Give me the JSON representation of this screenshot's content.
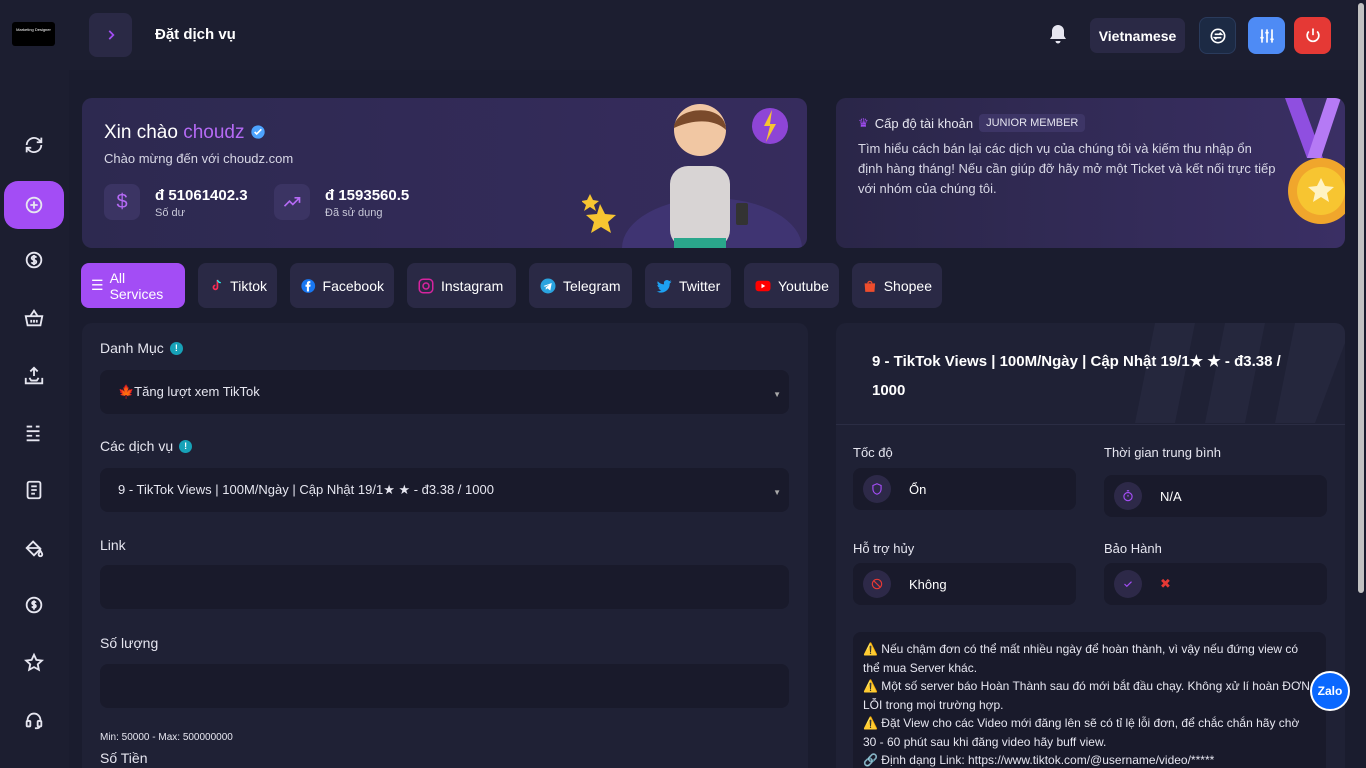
{
  "app": {
    "logo_text": "Marketing Designer"
  },
  "header": {
    "title": "Đặt dịch vụ",
    "language": "Vietnamese"
  },
  "welcome": {
    "greeting": "Xin chào",
    "username": "choudz",
    "subtitle": "Chào mừng đến với choudz.com",
    "balance_value": "đ 51061402.3",
    "balance_label": "Số dư",
    "used_value": "đ 1593560.5",
    "used_label": "Đã sử dụng"
  },
  "level": {
    "title": "Cấp độ tài khoản",
    "badge": "JUNIOR MEMBER",
    "text": "Tìm hiểu cách bán lại các dịch vụ của chúng tôi và kiếm thu nhập ổn định hàng tháng! Nếu cần giúp đỡ hãy mở một Ticket và kết nối trực tiếp với nhóm của chúng tôi."
  },
  "tabs": [
    {
      "label": "All Services",
      "icon": "list-icon"
    },
    {
      "label": "Tiktok",
      "icon": "tiktok-icon"
    },
    {
      "label": "Facebook",
      "icon": "facebook-icon"
    },
    {
      "label": "Instagram",
      "icon": "instagram-icon"
    },
    {
      "label": "Telegram",
      "icon": "telegram-icon"
    },
    {
      "label": "Twitter",
      "icon": "twitter-icon"
    },
    {
      "label": "Youtube",
      "icon": "youtube-icon"
    },
    {
      "label": "Shopee",
      "icon": "shopee-icon"
    }
  ],
  "form": {
    "category_label": "Danh Mục",
    "category_value": "🍁Tăng lượt xem TikTok",
    "service_label": "Các dịch vụ",
    "service_value": "9 - TikTok Views | 100M/Ngày | Cập Nhật 19/1★ ★ - đ3.38 / 1000",
    "link_label": "Link",
    "quantity_label": "Số lượng",
    "min_max": "Min: 50000 - Max: 500000000",
    "amount_label": "Số Tiền"
  },
  "detail": {
    "title": "9 - TikTok Views | 100M/Ngày | Cập Nhật 19/1★ ★ - đ3.38 / 1000",
    "speed_label": "Tốc độ",
    "speed_value": "Ổn",
    "avg_time_label": "Thời gian trung bình",
    "avg_time_value": "N/A",
    "cancel_label": "Hỗ trợ hủy",
    "cancel_value": "Không",
    "warranty_label": "Bảo Hành",
    "warranty_value": "✖",
    "notes": [
      "⚠️ Nếu chậm đơn có thể mất nhiều ngày để hoàn thành, vì vậy nếu đứng view có thể mua Server khác.",
      "⚠️ Một số server báo Hoàn Thành sau đó mới bắt đầu chạy. Không xử lí hoàn ĐƠN LỖI trong mọi trường hợp.",
      "⚠️ Đặt View cho các Video mới đăng lên sẽ có tỉ lệ lỗi đơn, để chắc chắn hãy chờ 30 - 60 phút sau khi đăng video hãy buff view.",
      "🔗 Định dạng Link: https://www.tiktok.com/@username/video/*****"
    ]
  },
  "zalo": "Zalo",
  "colors": {
    "accent": "#a34df5",
    "background": "#1a1c2e",
    "panel": "#1f2135"
  }
}
